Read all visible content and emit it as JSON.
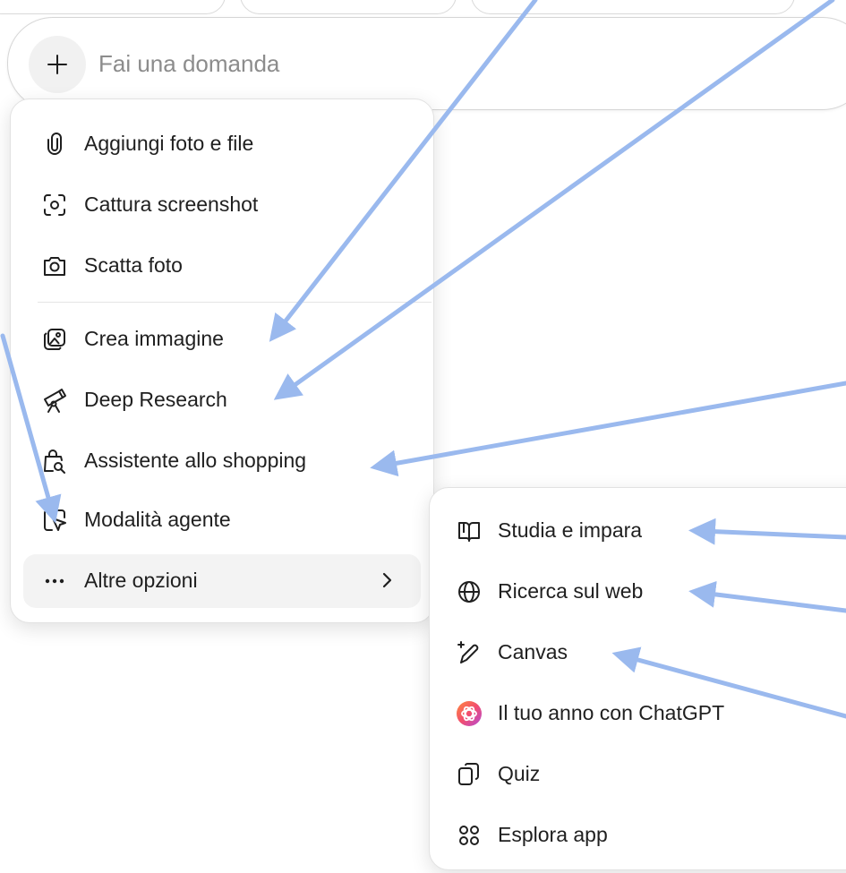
{
  "composer": {
    "placeholder": "Fai una domanda",
    "plus_icon": "plus-icon"
  },
  "menu": {
    "items": [
      {
        "label": "Aggiungi foto e file",
        "icon": "paperclip-icon"
      },
      {
        "label": "Cattura screenshot",
        "icon": "screenshot-icon"
      },
      {
        "label": "Scatta foto",
        "icon": "camera-icon"
      },
      {
        "label": "Crea immagine",
        "icon": "create-image-icon"
      },
      {
        "label": "Deep Research",
        "icon": "telescope-icon"
      },
      {
        "label": "Assistente allo shopping",
        "icon": "shopping-bag-icon"
      },
      {
        "label": "Modalità agente",
        "icon": "agent-cursor-icon"
      },
      {
        "label": "Altre opzioni",
        "icon": "more-dots-icon"
      }
    ]
  },
  "submenu": {
    "items": [
      {
        "label": "Studia e impara",
        "icon": "book-icon"
      },
      {
        "label": "Ricerca sul web",
        "icon": "globe-icon"
      },
      {
        "label": "Canvas",
        "icon": "pencil-sparkle-icon"
      },
      {
        "label": "Il tuo anno con ChatGPT",
        "icon": "chatgpt-logo-icon"
      },
      {
        "label": "Quiz",
        "icon": "cards-icon"
      },
      {
        "label": "Esplora app",
        "icon": "apps-grid-icon"
      }
    ]
  },
  "colors": {
    "arrow": "#9ab9ee",
    "menu_border": "#e2e2e2",
    "active_item_bg": "#f3f3f3",
    "placeholder_text": "#8c8c8c"
  }
}
